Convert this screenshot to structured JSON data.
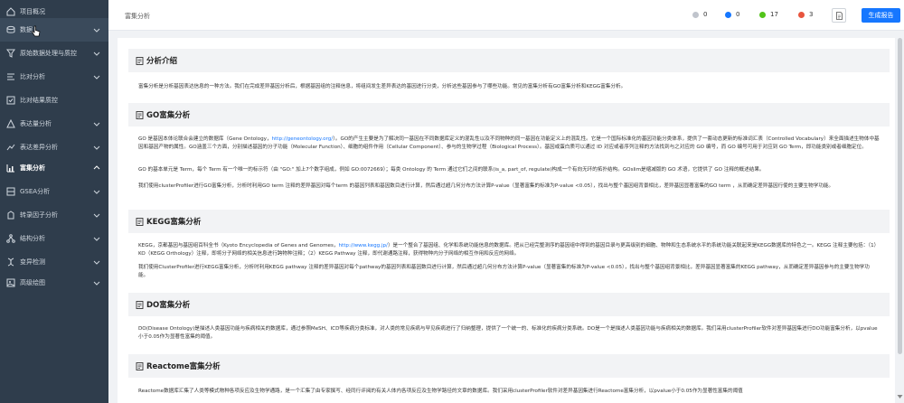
{
  "sidebar": {
    "items": [
      {
        "label": "项目概况",
        "icon": "home-icon"
      },
      {
        "label": "数据",
        "icon": "data-icon"
      },
      {
        "label": "原始数据处理与质控",
        "icon": "filter-icon"
      },
      {
        "label": "比对分析",
        "icon": "align-icon"
      },
      {
        "label": "比对结果质控",
        "icon": "check-icon"
      },
      {
        "label": "表达量分析",
        "icon": "chart-icon"
      },
      {
        "label": "表达差异分析",
        "icon": "diff-icon"
      },
      {
        "label": "富集分析",
        "icon": "enrich-icon"
      },
      {
        "label": "GSEA分析",
        "icon": "gsea-icon"
      },
      {
        "label": "转录因子分析",
        "icon": "tf-icon"
      },
      {
        "label": "结构分析",
        "icon": "structure-icon"
      },
      {
        "label": "变异检测",
        "icon": "variant-icon"
      },
      {
        "label": "高级绘图",
        "icon": "plot-icon"
      }
    ]
  },
  "topbar": {
    "title": "富集分析",
    "stats": [
      {
        "value": "0",
        "color": "#c0c4cc"
      },
      {
        "value": "0",
        "color": "#1677ff"
      },
      {
        "value": "17",
        "color": "#52c41a"
      },
      {
        "value": "3",
        "color": "#e8553e"
      }
    ],
    "report_label": "生成报告"
  },
  "sections": {
    "intro": {
      "title": "分析介绍",
      "text": "富集分析是分析基因表达信息的一种方法。我们在完成差异基因分析后，根据基因组的注释信息，将组间发生差异表达的基因进行分类，分析这些基因参与了哪些功能。常见的富集分析有GO富集分析和KEGG富集分析。"
    },
    "go": {
      "title": "GO富集分析",
      "p1_before": "GO 是基因本体论联合会建立的数据库（Gene Ontology，",
      "p1_link": "http://geneontology.org/",
      "p1_after": "）。GO的产生主要是为了解决同一基因在不同数据库定义的混乱性以及不同物种的同一基因在功能定义上的混乱性。它是一个国际标准化的基因功能分类体系，提供了一套动态更新的标准词汇表（Controlled Vocabulary）来全面描述生物体中基因和基因产物的属性。GO涵盖三个方面，分别描述基因的分子功能（Molecular Function）、细胞的组件作用（Cellular Component）、参与的生物学过程（Biological Process）。基因或蛋白质可以通过 ID 对应或者序列注释的方法找到与之对应的 GO 编号，而 GO 编号可用于对应到 GO Term，即功能类别或者细胞定位。",
      "p2": "GO 的基本单元是 Term，每个 Term 有一个唯一的标示符（由 \"GO:\" 加上7个数字组成，例如 GO:0072669）；每类 Ontology 的 Term 通过它们之间的联系(is_a, part_of, regulate)构成一个有向无环的拓扑结构。GOslim是缩减版的 GO 术语，它提供了 GO 注释的概述结果。",
      "p3": "我们使用clusterProfiler进行GO富集分析，分析时利用GO term 注释的差异基因对每个term 的基因列表和基因数目进行计算，然后通过超几何分布方法计算P-value（显著富集的标准为P-value <0.05），找出与整个基因组背景相比，差异基因显著富集的GO term ，从而确定差异基因行使的主要生物学功能。"
    },
    "kegg": {
      "title": "KEGG富集分析",
      "p1_before": "KEGG，京都基因与基因组百科全书（Kyoto Encyclopedia of Genes and Genomes，",
      "p1_link": "http://www.kegg.jp/",
      "p1_after": "）是一个整合了基因组、化学和系统功能信息的数据库。把从已经完整测序的基因组中得到的基因目录与更高级别的细胞、物种和生态系统水平的系统功能关联起来是KEGG数据库的特色之一。KEGG 注释主要包括：（1）KO（KEGG Orthology）注释，即将分子网络的相关信息进行跨物种注释；（2）KEGG Pathway 注释，即代谢通路注释，获得物种内分子网络的相互作用和反应的网络。",
      "p2": "我们使用ClusterProfiler进行KEGG富集分析，分析时利用KEGG pathway 注释的差异基因对每个pathway的基因列表和基因数目进行计算，然后通过超几何分布方法计算P-value（显著富集的标准为P-value <0.05），找出与整个基因组背景相比，差异基因显著富集的KEGG pathway，从而确定差异基因参与的主要生物学功能。"
    },
    "do": {
      "title": "DO富集分析",
      "text": "DO(Disease Ontology)是描述人类基因功能与疾病相关的数据库，通过参照MeSH、ICD等疾病分类标准，对人类的常见疾病与罕见疾病进行了归纳整理，提供了一个统一的、标准化的疾病分类系统。DO是一个是描述人类基因功能与疾病相关的数据库。我们采用clusterProfiler软件对差异基因集进行DO功能富集分析，以pvalue小于0.05作为显著性富集的阈值。"
    },
    "reactome": {
      "title": "Reactome富集分析",
      "text": "Reactome数据库汇集了人类等模式物种各项反应及生物学通路，是一个汇集了由专家撰写、经同行评阅的有关人体内各项反应及生物学路径的文章的数据库。我们采用clusterProfiler软件对差异基因集进行Reactome富集分析，以pvalue小于0.05作为显著性富集的阈值"
    }
  }
}
